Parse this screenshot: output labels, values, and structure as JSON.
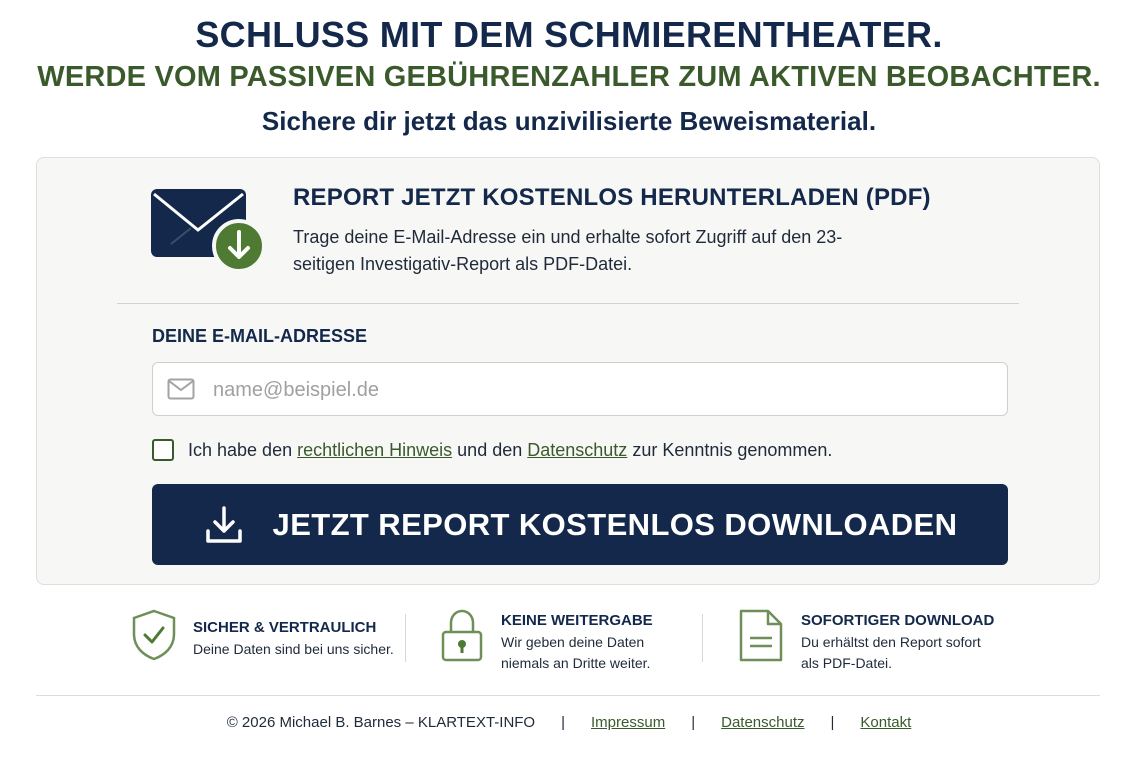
{
  "hero": {
    "headline": "SCHLUSS MIT DEM SCHMIERENTHEATER.",
    "subheadline": "WERDE VOM PASSIVEN GEBÜHRENZAHLER ZUM AKTIVEN BEOBACHTER.",
    "tagline": "Sichere dir jetzt das unzivilisierte Beweismaterial."
  },
  "card": {
    "title": "REPORT JETZT KOSTENLOS HERUNTERLADEN (PDF)",
    "description": "Trage deine E-Mail-Adresse ein und erhalte sofort Zugriff auf den 23-seitigen Investigativ-Report als PDF-Datei.",
    "icon": "envelope-download-icon"
  },
  "form": {
    "email_label": "DEINE E-MAIL-ADRESSE",
    "email_placeholder": "name@beispiel.de",
    "email_value": "",
    "consent_prefix": "Ich habe den ",
    "consent_link1": "rechtlichen Hinweis",
    "consent_middle": " und den ",
    "consent_link2": "Datenschutz",
    "consent_suffix": " zur Kenntnis genommen.",
    "consent_checked": false,
    "submit_label": "JETZT REPORT KOSTENLOS DOWNLOADEN"
  },
  "features": [
    {
      "title": "SICHER & VERTRAULICH",
      "line1": "Deine Daten sind bei uns sicher.",
      "line2": "",
      "icon": "shield-check-icon"
    },
    {
      "title": "KEINE WEITERGABE",
      "line1": "Wir geben deine Daten",
      "line2": "niemals an Dritte weiter.",
      "icon": "lock-icon"
    },
    {
      "title": "SOFORTIGER DOWNLOAD",
      "line1": "Du erhältst den Report sofort",
      "line2": "als PDF-Datei.",
      "icon": "document-icon"
    }
  ],
  "footer": {
    "copyright": "© 2026 Michael B. Barnes – KLARTEXT-INFO",
    "separator": "|",
    "links": [
      "Impressum",
      "Datenschutz",
      "Kontakt"
    ]
  },
  "colors": {
    "navy": "#13284a",
    "green": "#3b5a2c",
    "card_bg": "#f7f7f5"
  }
}
